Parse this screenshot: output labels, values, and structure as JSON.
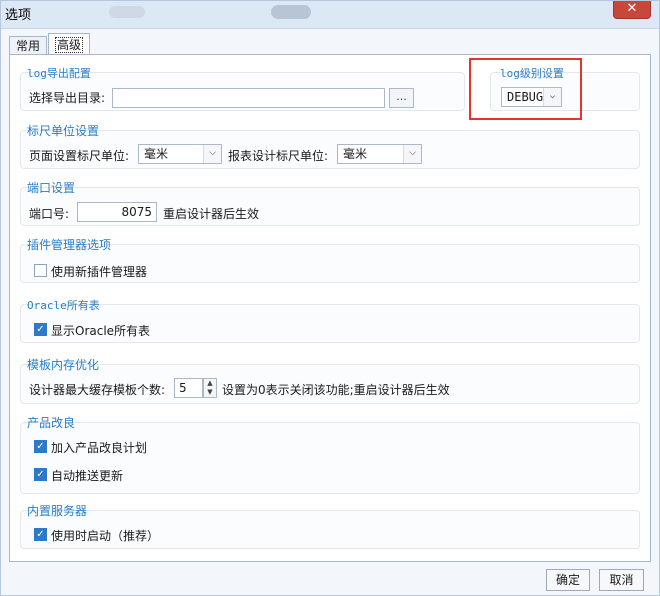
{
  "window": {
    "title": "选项",
    "close_label": "✕"
  },
  "tabs": [
    {
      "label": "常用",
      "active": false
    },
    {
      "label": "高级",
      "active": true
    }
  ],
  "log_export": {
    "title": "log导出配置",
    "dir_label": "选择导出目录:",
    "dir_value": "",
    "browse_label": "..."
  },
  "log_level": {
    "title": "log级别设置",
    "selected": "DEBUG"
  },
  "ruler": {
    "title": "标尺单位设置",
    "page_label": "页面设置标尺单位:",
    "page_value": "毫米",
    "report_label": "报表设计标尺单位:",
    "report_value": "毫米"
  },
  "port": {
    "title": "端口设置",
    "label": "端口号:",
    "value": "8075",
    "hint": "重启设计器后生效"
  },
  "plugin": {
    "title": "插件管理器选项",
    "checkbox_label": "使用新插件管理器",
    "checked": false
  },
  "oracle": {
    "title": "Oracle所有表",
    "checkbox_label": "显示Oracle所有表",
    "checked": true
  },
  "cache": {
    "title": "模板内存优化",
    "label": "设计器最大缓存模板个数:",
    "value": "5",
    "hint": "设置为0表示关闭该功能;重启设计器后生效"
  },
  "improve": {
    "title": "产品改良",
    "items": [
      {
        "label": "加入产品改良计划",
        "checked": true
      },
      {
        "label": "自动推送更新",
        "checked": true
      }
    ]
  },
  "server": {
    "title": "内置服务器",
    "checkbox_label": "使用时启动（推荐）",
    "checked": true
  },
  "buttons": {
    "ok": "确定",
    "cancel": "取消"
  },
  "icons": {
    "check": "✓",
    "chevron_down": "⌵",
    "spin_up": "▲",
    "spin_down": "▼"
  },
  "colors": {
    "accent": "#2a7ec4",
    "highlight_box": "#e8332a",
    "check_fill": "#2d78c8"
  }
}
